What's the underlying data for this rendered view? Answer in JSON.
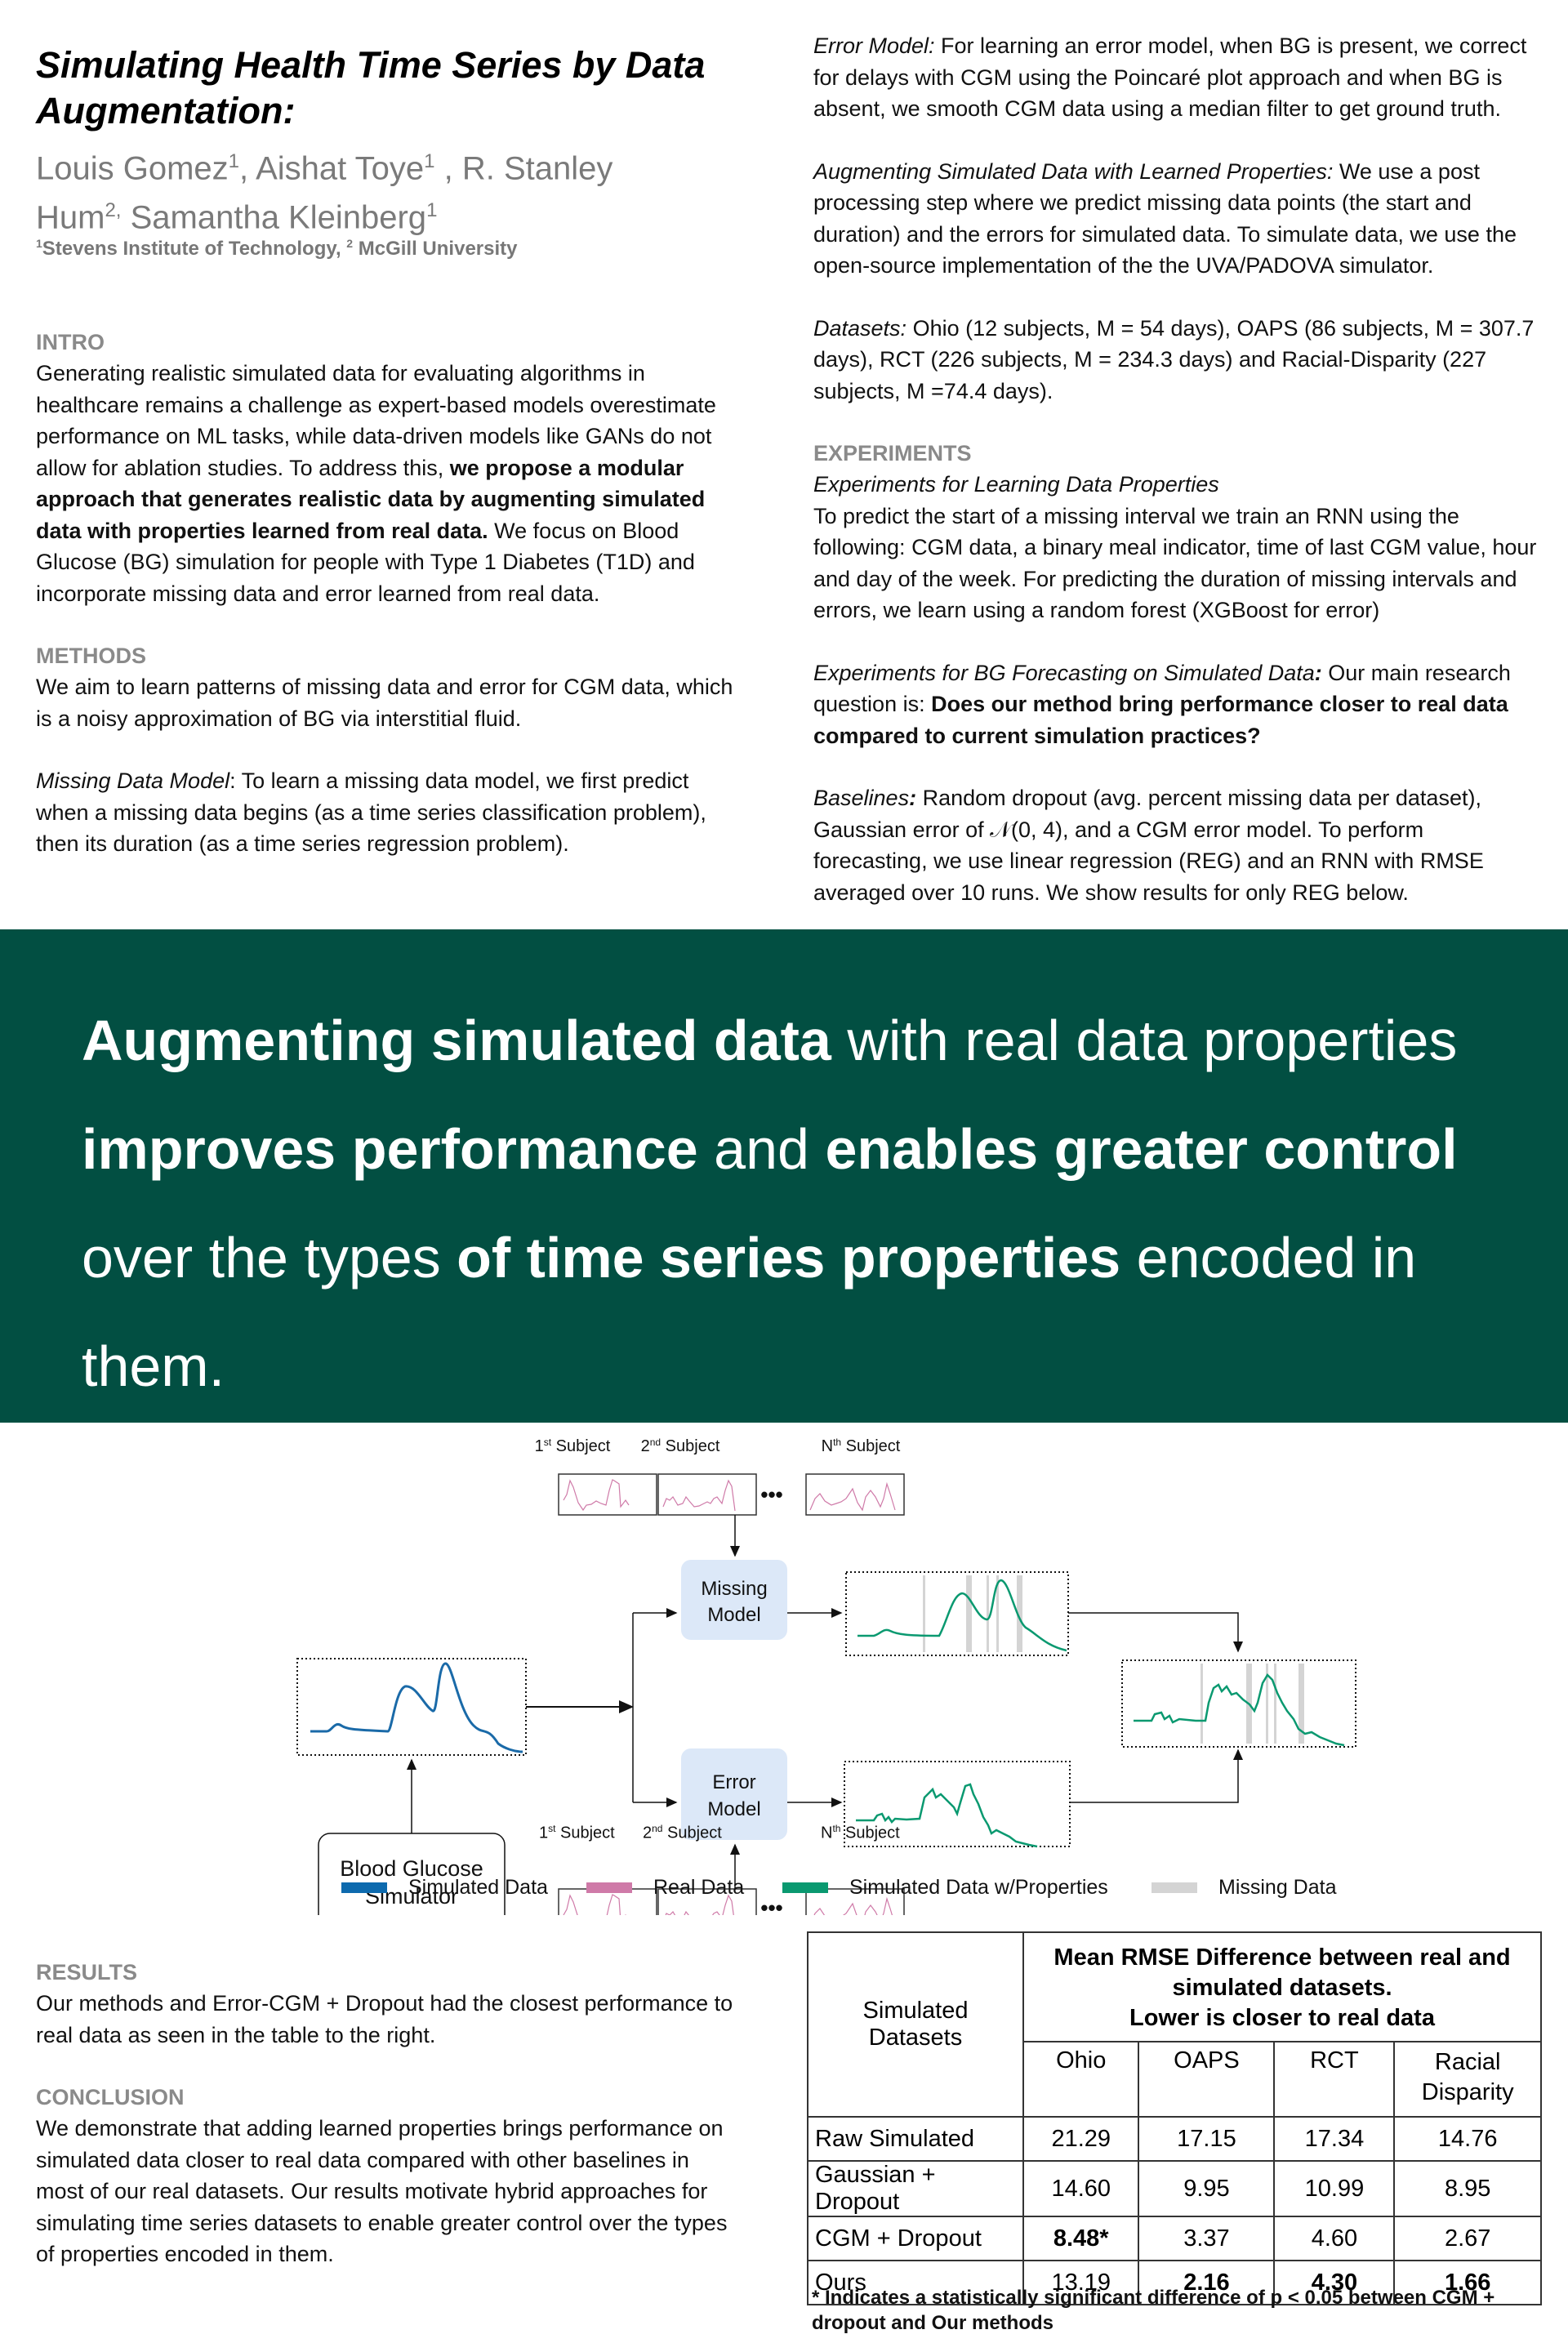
{
  "header": {
    "title": "Simulating Health Time Series by Data Augmentation:",
    "authors": [
      {
        "name": "Louis Gomez",
        "sup": "1"
      },
      {
        "name": "Aishat Toye",
        "sup": "1"
      },
      {
        "name": "R. Stanley Hum",
        "sup": "2,"
      },
      {
        "name": "Samantha Kleinberg",
        "sup": "1"
      }
    ],
    "affiliations": {
      "sup1": "1",
      "inst1": "Stevens Institute of Technology,",
      "sup2": "2",
      "inst2": "McGill University"
    }
  },
  "intro": {
    "heading": "INTRO",
    "text_before": "Generating realistic simulated data for evaluating algorithms in healthcare remains a challenge as expert-based models overestimate performance on ML tasks, while data-driven models like GANs do not allow for ablation studies. To address this, ",
    "text_bold": "we propose a modular approach that generates realistic data by augmenting simulated data with properties learned from real data.",
    "text_after": " We focus on Blood Glucose (BG) simulation for people with Type 1 Diabetes (T1D) and incorporate missing data and error learned from real data."
  },
  "methods": {
    "heading": "METHODS",
    "p1": "We aim to learn patterns of missing data and error for CGM data, which is a noisy approximation of BG via interstitial fluid.",
    "missing_label": "Missing Data Model",
    "missing_text": ": To learn a missing data model, we first predict when a missing data begins (as a time series classification problem), then its duration (as a time series regression problem).",
    "error_label": "Error Model:",
    "error_text": " For learning an error model, when BG is present, we correct for delays with CGM using the Poincaré plot approach and when BG is absent, we smooth CGM data using a median filter to get ground truth.",
    "augment_label": "Augmenting Simulated Data with Learned Properties:",
    "augment_text": " We use a post processing step where we predict missing data points (the start and duration) and the errors for simulated data. To simulate data, we use the open-source implementation of the the UVA/PADOVA simulator.",
    "datasets_label": "Datasets:",
    "datasets_text": " Ohio (12 subjects, M = 54 days), OAPS (86 subjects, M = 307.7 days), RCT (226 subjects, M = 234.3 days) and Racial-Disparity (227 subjects, M =74.4 days)."
  },
  "experiments": {
    "heading": "EXPERIMENTS",
    "sub1": "Experiments for Learning Data Properties",
    "sub1_text": "To predict the start of a missing interval we train an RNN using the following: CGM data, a binary meal indicator, time of last CGM value, hour and day of the week. For predicting the duration of missing intervals and errors, we learn using a random forest (XGBoost for error)",
    "sub2": "Experiments for BG Forecasting on Simulated Data",
    "sub2_colon": ":",
    "sub2_text": " Our main research question is: ",
    "sub2_bold": "Does our method bring performance closer to real data compared to current simulation practices?",
    "baselines_label": "Baselines",
    "baselines_colon": ":",
    "baselines_text": " Random dropout (avg. percent missing data per dataset), Gaussian error of 𝒩(0, 4), and a CGM error model. To perform forecasting, we use linear regression (REG) and an RNN with RMSE averaged over 10 runs. We show results for only REG below."
  },
  "banner": {
    "color": "#024f42",
    "segments": [
      {
        "text": "Augmenting simulated data",
        "bold": true
      },
      {
        "text": " with real data properties ",
        "bold": false
      },
      {
        "text": "improves performance",
        "bold": true
      },
      {
        "text": " and ",
        "bold": false
      },
      {
        "text": "enables greater control",
        "bold": true
      },
      {
        "text": " over the types ",
        "bold": false
      },
      {
        "text": "of time series properties",
        "bold": true
      },
      {
        "text": " encoded in them.",
        "bold": false
      }
    ]
  },
  "diagram": {
    "top_subjects": [
      "1st Subject",
      "2nd Subject",
      "Nth Subject"
    ],
    "bottom_subjects": [
      "1st Subject",
      "2nd Subject",
      "Nth Subject"
    ],
    "subject_labels": [
      {
        "n": "1",
        "sup": "st",
        "t": " Subject"
      },
      {
        "n": "2",
        "sup": "nd",
        "t": " Subject"
      },
      {
        "n": "N",
        "sup": "th",
        "t": " Subject"
      }
    ],
    "ellipsis": "•••",
    "missing_model": [
      "Missing",
      "Model"
    ],
    "error_model": [
      "Error",
      "Model"
    ],
    "simulator": [
      "Blood Glucose",
      "Simulator"
    ],
    "colors": {
      "simulated": "#1a6aa8",
      "real": "#cf7aa8",
      "with_properties": "#0a9970",
      "missing": "#d4d4d4",
      "model_box": "#dce8f8"
    }
  },
  "legend": [
    {
      "label": "Simulated Data",
      "color": "#0d6aae"
    },
    {
      "label": "Real Data",
      "color": "#cf7aa8"
    },
    {
      "label": "Simulated Data w/Properties",
      "color": "#0a9970"
    },
    {
      "label": "Missing Data",
      "color": "#d4d4d4"
    }
  ],
  "results": {
    "heading": "RESULTS",
    "text": "Our methods and Error-CGM + Dropout had the closest performance to real data as seen in the table to the right."
  },
  "conclusion": {
    "heading": "CONCLUSION",
    "text": "We demonstrate that adding learned properties brings performance on simulated data closer to real data compared with other baselines in most of our real datasets. Our results motivate hybrid approaches for simulating time series datasets to enable greater control over the types of properties encoded in them."
  },
  "table": {
    "row_header": "Simulated Datasets",
    "caption_lines": [
      "Mean RMSE Difference between real and",
      "simulated datasets.",
      "Lower is closer to real data"
    ],
    "columns": [
      "Ohio",
      "OAPS",
      "RCT",
      "Racial Disparity"
    ],
    "rows": [
      {
        "label": "Raw Simulated",
        "values": [
          "21.29",
          "17.15",
          "17.34",
          "14.76"
        ],
        "bold": [
          false,
          false,
          false,
          false
        ]
      },
      {
        "label": "Gaussian + Dropout",
        "values": [
          "14.60",
          "9.95",
          "10.99",
          "8.95"
        ],
        "bold": [
          false,
          false,
          false,
          false
        ]
      },
      {
        "label": "CGM + Dropout",
        "values": [
          "8.48*",
          "3.37",
          "4.60",
          "2.67"
        ],
        "bold": [
          true,
          false,
          false,
          false
        ]
      },
      {
        "label": "Ours",
        "values": [
          "13.19",
          "2.16",
          "4.30",
          "1.66"
        ],
        "bold": [
          false,
          true,
          true,
          true
        ]
      }
    ],
    "footnote": "* Indicates a statistically significant difference of p < 0.05 between CGM + dropout and Our methods"
  }
}
